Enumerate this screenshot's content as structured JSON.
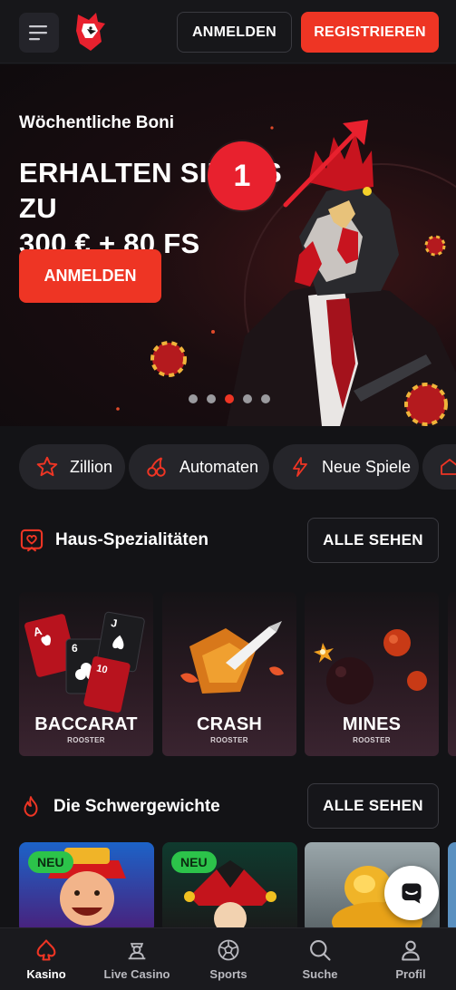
{
  "header": {
    "login_label": "ANMELDEN",
    "register_label": "REGISTRIEREN"
  },
  "hero": {
    "subtitle": "Wöchentliche Boni",
    "title_line1": "ERHALTEN SIE BIS ZU",
    "title_line2": "300 € + 80 FS",
    "cta_label": "ANMELDEN",
    "step_badge": "1",
    "slides_total": 5,
    "active_slide": 3
  },
  "categories": [
    {
      "label": "Zillion",
      "icon": "star-icon"
    },
    {
      "label": "Automaten",
      "icon": "cherries-icon"
    },
    {
      "label": "Neue Spiele",
      "icon": "lightning-icon"
    }
  ],
  "sections": {
    "specials": {
      "title": "Haus-Spezialitäten",
      "see_all": "ALLE SEHEN",
      "icon": "heart-badge-icon"
    },
    "heavyweights": {
      "title": "Die Schwergewichte",
      "see_all": "ALLE SEHEN",
      "icon": "flame-icon"
    }
  },
  "games": [
    {
      "name": "BACCARAT",
      "brand": "ROOSTER"
    },
    {
      "name": "CRASH",
      "brand": "ROOSTER"
    },
    {
      "name": "MINES",
      "brand": "ROOSTER"
    }
  ],
  "heavyweight_games": [
    {
      "badge": "NEU"
    },
    {
      "badge": "NEU"
    }
  ],
  "bottom_nav": [
    {
      "label": "Kasino",
      "icon": "spade-icon",
      "active": true
    },
    {
      "label": "Live Casino",
      "icon": "dealer-icon",
      "active": false
    },
    {
      "label": "Sports",
      "icon": "soccer-ball-icon",
      "active": false
    },
    {
      "label": "Suche",
      "icon": "search-icon",
      "active": false
    },
    {
      "label": "Profil",
      "icon": "user-icon",
      "active": false
    }
  ],
  "colors": {
    "accent": "#ee3524",
    "background": "#131316",
    "new_badge": "#2cc34a"
  }
}
